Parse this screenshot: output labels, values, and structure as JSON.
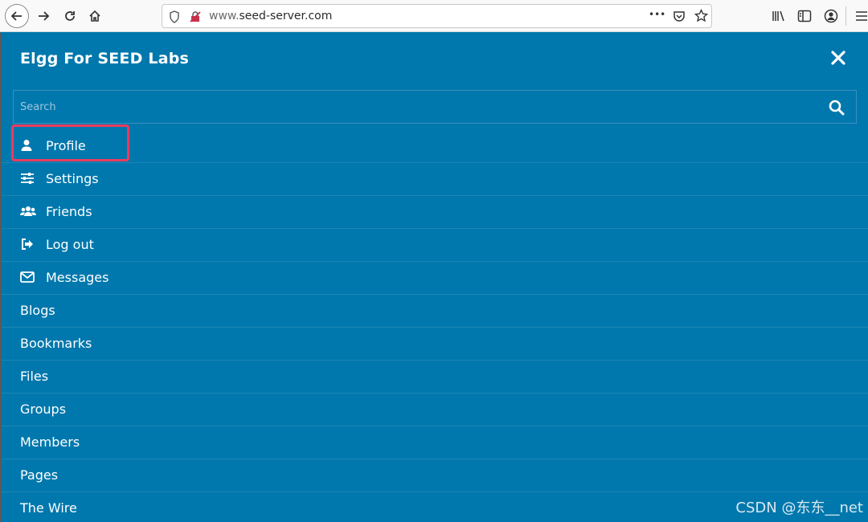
{
  "browser": {
    "url_prefix": "www.",
    "url_domain": "seed-server.com",
    "more_label": "•••"
  },
  "site": {
    "title": "Elgg For SEED Labs"
  },
  "search": {
    "placeholder": "Search"
  },
  "user_menu": [
    {
      "label": "Profile",
      "icon": "user-icon"
    },
    {
      "label": "Settings",
      "icon": "sliders-icon"
    },
    {
      "label": "Friends",
      "icon": "users-icon"
    },
    {
      "label": "Log out",
      "icon": "sign-out-icon"
    },
    {
      "label": "Messages",
      "icon": "envelope-icon"
    }
  ],
  "site_menu": [
    {
      "label": "Blogs"
    },
    {
      "label": "Bookmarks"
    },
    {
      "label": "Files"
    },
    {
      "label": "Groups"
    },
    {
      "label": "Members"
    },
    {
      "label": "Pages"
    },
    {
      "label": "The Wire"
    }
  ],
  "watermark": "CSDN @东东__net",
  "colors": {
    "panel_bg": "#0078ad",
    "highlight_border": "#ec3c5e"
  }
}
